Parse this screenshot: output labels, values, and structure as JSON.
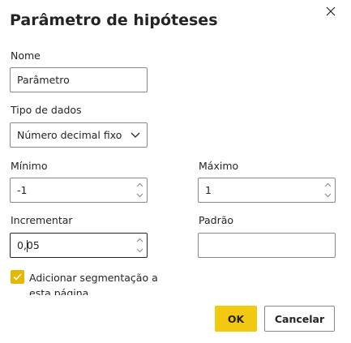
{
  "dialog": {
    "title": "Parâmetro de hipóteses",
    "close_icon": "close-icon"
  },
  "nome": {
    "label": "Nome",
    "value": "Parâmetro"
  },
  "tipo_dados": {
    "label": "Tipo de dados",
    "selected": "Número decimal fixo"
  },
  "minimo": {
    "label": "Mínimo",
    "value": "-1"
  },
  "maximo": {
    "label": "Máximo",
    "value": "1"
  },
  "incrementar": {
    "label": "Incrementar",
    "value": "0,05"
  },
  "padrao": {
    "label": "Padrão",
    "value": ""
  },
  "slicer_option": {
    "checked": true,
    "label": "Adicionar segmentação a esta página"
  },
  "buttons": {
    "ok": "OK",
    "cancel": "Cancelar"
  },
  "colors": {
    "accent": "#f2c811",
    "checkbox": "#e5b700",
    "text": "#252423",
    "border": "#8a8886"
  }
}
